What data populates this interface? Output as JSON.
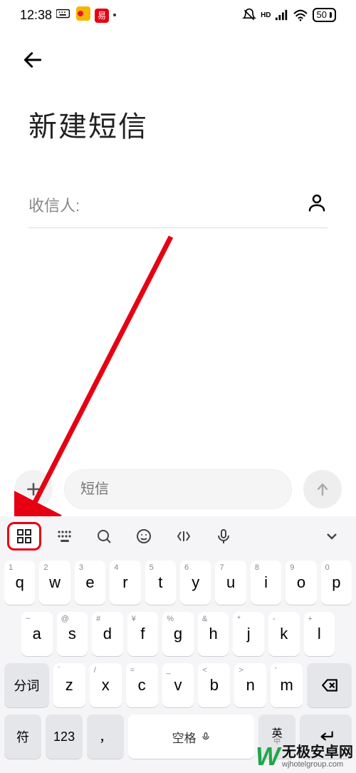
{
  "status": {
    "time": "12:38",
    "battery": "50"
  },
  "page": {
    "title": "新建短信"
  },
  "recipient": {
    "label": "收信人:"
  },
  "compose": {
    "placeholder": "短信"
  },
  "keyboard": {
    "row1": [
      {
        "sup": "1",
        "main": "q"
      },
      {
        "sup": "2",
        "main": "w"
      },
      {
        "sup": "3",
        "main": "e"
      },
      {
        "sup": "4",
        "main": "r"
      },
      {
        "sup": "5",
        "main": "t"
      },
      {
        "sup": "6",
        "main": "y"
      },
      {
        "sup": "7",
        "main": "u"
      },
      {
        "sup": "8",
        "main": "i"
      },
      {
        "sup": "9",
        "main": "o"
      },
      {
        "sup": "0",
        "main": "p"
      }
    ],
    "row2": [
      {
        "sup": "~",
        "main": "a"
      },
      {
        "sup": "@",
        "main": "s"
      },
      {
        "sup": "#",
        "main": "d"
      },
      {
        "sup": "¥",
        "main": "f"
      },
      {
        "sup": "%",
        "main": "g"
      },
      {
        "sup": "&",
        "main": "h"
      },
      {
        "sup": "*",
        "main": "j"
      },
      {
        "sup": "-",
        "main": "k"
      },
      {
        "sup": "+",
        "main": "l"
      }
    ],
    "row3_shift": "分词",
    "row3": [
      {
        "sup": "`",
        "main": "z"
      },
      {
        "sup": "/",
        "main": "x"
      },
      {
        "sup": "=",
        "main": "c"
      },
      {
        "sup": "_",
        "main": "v"
      },
      {
        "sup": "<",
        "main": "b"
      },
      {
        "sup": ">",
        "main": "n"
      },
      {
        "sup": "'",
        "main": "m"
      }
    ],
    "row4": {
      "sym": "符",
      "num": "123",
      "comma": "，",
      "space": "空格",
      "lang": "英",
      "lang2": "中"
    }
  },
  "watermark": {
    "cn": "无极安卓网",
    "url": "wjhotelgroup.com"
  }
}
